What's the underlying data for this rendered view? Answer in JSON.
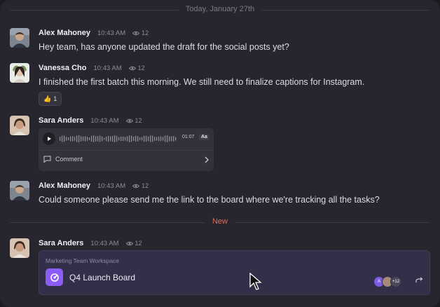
{
  "date_divider": "Today, January 27th",
  "new_divider": "New",
  "messages": [
    {
      "author": "Alex Mahoney",
      "time": "10:43 AM",
      "views": "12",
      "text": "Hey team, has anyone updated the draft for the social posts yet?"
    },
    {
      "author": "Vanessa Cho",
      "time": "10:43 AM",
      "views": "12",
      "text": "I finished the first batch this morning. We still need to finalize captions for Instagram.",
      "reaction": {
        "emoji": "👍",
        "count": "1"
      }
    },
    {
      "author": "Sara Anders",
      "time": "10:43 AM",
      "views": "12",
      "voice": {
        "duration": "01:07",
        "speed_label": "Aa",
        "comment_label": "Comment"
      }
    },
    {
      "author": "Alex Mahoney",
      "time": "10:43 AM",
      "views": "12",
      "text": "Could someone please send me the link to the board where we're tracking all the tasks?"
    },
    {
      "author": "Sara Anders",
      "time": "10:43 AM",
      "views": "12",
      "card": {
        "workspace": "Marketing Team Workspace",
        "title": "Q4 Launch Board",
        "avatar_initial": "A",
        "extra_count": "+12"
      }
    }
  ],
  "colors": {
    "accent": "#8b5cf6",
    "new_divider": "#e06a5b",
    "panel": "#27262f"
  },
  "icons": [
    "eye-icon",
    "thumbs-up-icon",
    "play-icon",
    "comment-icon",
    "chevron-right-icon",
    "board-icon",
    "share-icon",
    "cursor-icon"
  ]
}
